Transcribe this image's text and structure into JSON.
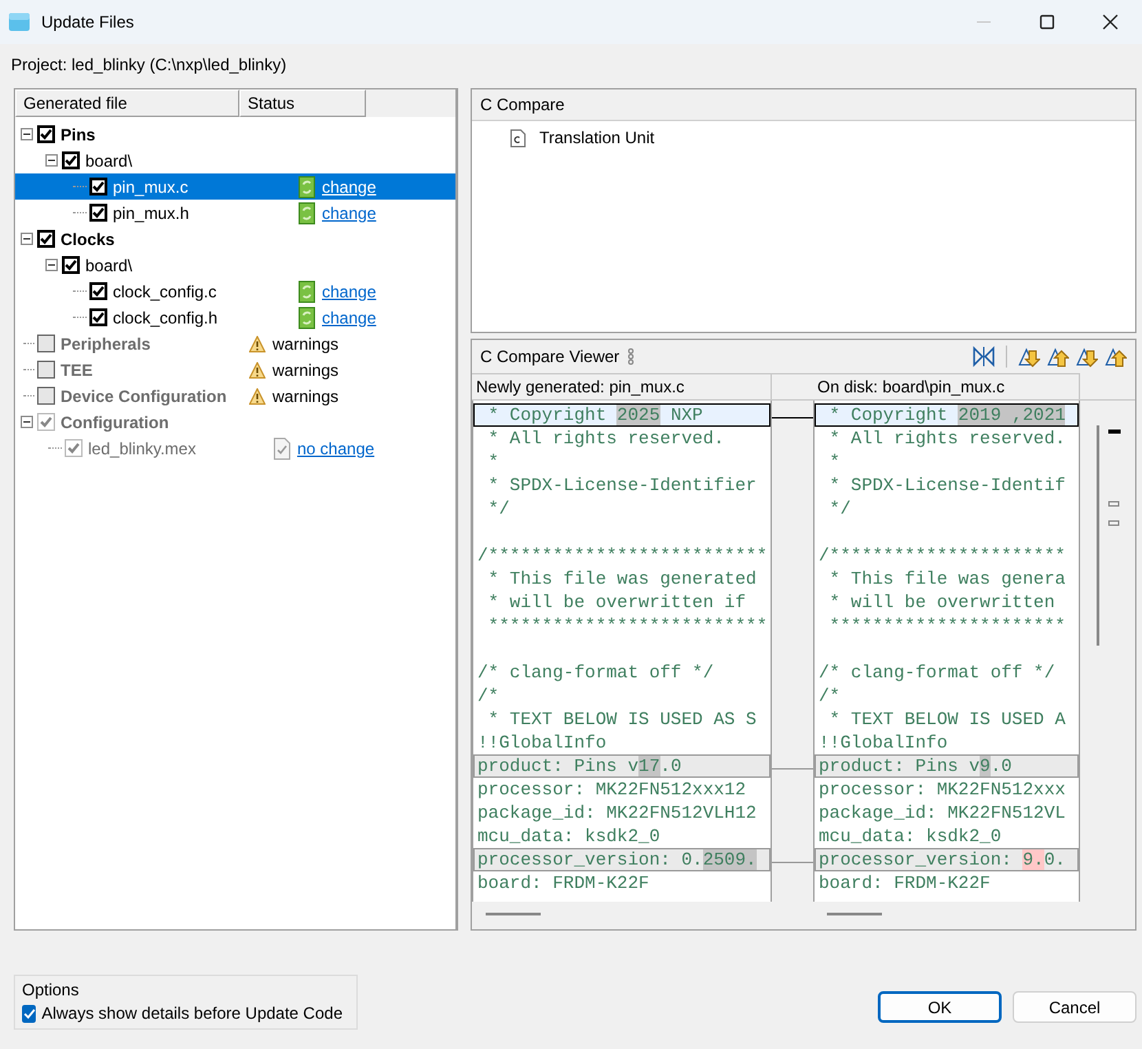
{
  "window": {
    "title": "Update Files"
  },
  "project": "Project: led_blinky (C:\\nxp\\led_blinky)",
  "tree": {
    "columns": [
      "Generated file",
      "Status"
    ],
    "items": [
      {
        "label": "Pins",
        "kind": "group",
        "checked": true,
        "disabled": false,
        "expanded": true,
        "selected": false,
        "children": [
          {
            "label": "board\\",
            "kind": "item",
            "checked": true,
            "disabled": false,
            "expanded": true,
            "selected": false,
            "children": [
              {
                "label": "pin_mux.c",
                "kind": "item",
                "checked": true,
                "disabled": false,
                "selected": true,
                "status": {
                  "kind": "change",
                  "text": "change"
                }
              },
              {
                "label": "pin_mux.h",
                "kind": "item",
                "checked": true,
                "disabled": false,
                "selected": false,
                "status": {
                  "kind": "change",
                  "text": "change"
                }
              }
            ]
          }
        ]
      },
      {
        "label": "Clocks",
        "kind": "group",
        "checked": true,
        "disabled": false,
        "expanded": true,
        "selected": false,
        "children": [
          {
            "label": "board\\",
            "kind": "item",
            "checked": true,
            "disabled": false,
            "expanded": true,
            "selected": false,
            "children": [
              {
                "label": "clock_config.c",
                "kind": "item",
                "checked": true,
                "disabled": false,
                "selected": false,
                "status": {
                  "kind": "change",
                  "text": "change"
                }
              },
              {
                "label": "clock_config.h",
                "kind": "item",
                "checked": true,
                "disabled": false,
                "selected": false,
                "status": {
                  "kind": "change",
                  "text": "change"
                }
              }
            ]
          }
        ]
      },
      {
        "label": "Peripherals",
        "kind": "group",
        "checked": false,
        "disabled": true,
        "selected": false,
        "status": {
          "kind": "warning",
          "text": "warnings"
        }
      },
      {
        "label": "TEE",
        "kind": "group",
        "checked": false,
        "disabled": true,
        "selected": false,
        "status": {
          "kind": "warning",
          "text": "warnings"
        }
      },
      {
        "label": "Device Configuration",
        "kind": "group",
        "checked": false,
        "disabled": true,
        "selected": false,
        "status": {
          "kind": "warning",
          "text": "warnings"
        }
      },
      {
        "label": "Configuration",
        "kind": "group",
        "checked": true,
        "disabled": true,
        "expanded": true,
        "selected": false,
        "children": [
          {
            "label": "led_blinky.mex",
            "kind": "item",
            "checked": true,
            "disabled": true,
            "selected": false,
            "status": {
              "kind": "nochange",
              "text": "no change"
            }
          }
        ]
      }
    ]
  },
  "compare": {
    "title": "C Compare",
    "items": [
      {
        "label": "Translation Unit"
      }
    ]
  },
  "viewer": {
    "title": "C Compare Viewer",
    "left": {
      "title": "Newly generated: pin_mux.c",
      "lines": [
        {
          "kind": "current-diff",
          "segments": [
            {
              "kind": "plain",
              "text": " * Copyright "
            },
            {
              "kind": "change",
              "text": "2025"
            },
            {
              "kind": "plain",
              "text": " NXP"
            }
          ]
        },
        {
          "kind": "text",
          "segments": [
            {
              "kind": "plain",
              "text": " * All rights reserved."
            }
          ]
        },
        {
          "kind": "text",
          "segments": [
            {
              "kind": "plain",
              "text": " *"
            }
          ]
        },
        {
          "kind": "text",
          "segments": [
            {
              "kind": "plain",
              "text": " * SPDX-License-Identifier"
            }
          ]
        },
        {
          "kind": "text",
          "segments": [
            {
              "kind": "plain",
              "text": " */"
            }
          ]
        },
        {
          "kind": "blank"
        },
        {
          "kind": "text",
          "segments": [
            {
              "kind": "plain",
              "text": "/**************************"
            }
          ]
        },
        {
          "kind": "text",
          "segments": [
            {
              "kind": "plain",
              "text": " * This file was generated"
            }
          ]
        },
        {
          "kind": "text",
          "segments": [
            {
              "kind": "plain",
              "text": " * will be overwritten if"
            }
          ]
        },
        {
          "kind": "text",
          "segments": [
            {
              "kind": "plain",
              "text": " **************************"
            }
          ]
        },
        {
          "kind": "blank"
        },
        {
          "kind": "text",
          "segments": [
            {
              "kind": "plain",
              "text": "/* clang-format off */"
            }
          ]
        },
        {
          "kind": "text",
          "segments": [
            {
              "kind": "plain",
              "text": "/*"
            }
          ]
        },
        {
          "kind": "text",
          "segments": [
            {
              "kind": "plain",
              "text": " * TEXT BELOW IS USED AS S"
            }
          ]
        },
        {
          "kind": "text",
          "segments": [
            {
              "kind": "plain",
              "text": "!!GlobalInfo"
            }
          ]
        },
        {
          "kind": "diff",
          "segments": [
            {
              "kind": "plain",
              "text": "product: Pins v"
            },
            {
              "kind": "change",
              "text": "17"
            },
            {
              "kind": "plain",
              "text": ".0"
            }
          ]
        },
        {
          "kind": "text",
          "segments": [
            {
              "kind": "plain",
              "text": "processor: MK22FN512xxx12"
            }
          ]
        },
        {
          "kind": "text",
          "segments": [
            {
              "kind": "plain",
              "text": "package_id: MK22FN512VLH12"
            }
          ]
        },
        {
          "kind": "text",
          "segments": [
            {
              "kind": "plain",
              "text": "mcu_data: ksdk2_0"
            }
          ]
        },
        {
          "kind": "diff",
          "segments": [
            {
              "kind": "plain",
              "text": "processor_version: 0."
            },
            {
              "kind": "change",
              "text": "2509."
            }
          ]
        },
        {
          "kind": "text",
          "segments": [
            {
              "kind": "plain",
              "text": "board: FRDM-K22F"
            }
          ]
        }
      ]
    },
    "right": {
      "title": "On disk: board\\pin_mux.c",
      "lines": [
        {
          "kind": "current-diff",
          "segments": [
            {
              "kind": "plain",
              "text": " * Copyright "
            },
            {
              "kind": "change",
              "text": "2019 ,2021"
            }
          ]
        },
        {
          "kind": "text",
          "segments": [
            {
              "kind": "plain",
              "text": " * All rights reserved."
            }
          ]
        },
        {
          "kind": "text",
          "segments": [
            {
              "kind": "plain",
              "text": " *"
            }
          ]
        },
        {
          "kind": "text",
          "segments": [
            {
              "kind": "plain",
              "text": " * SPDX-License-Identif"
            }
          ]
        },
        {
          "kind": "text",
          "segments": [
            {
              "kind": "plain",
              "text": " */"
            }
          ]
        },
        {
          "kind": "blank"
        },
        {
          "kind": "text",
          "segments": [
            {
              "kind": "plain",
              "text": "/**********************"
            }
          ]
        },
        {
          "kind": "text",
          "segments": [
            {
              "kind": "plain",
              "text": " * This file was genera"
            }
          ]
        },
        {
          "kind": "text",
          "segments": [
            {
              "kind": "plain",
              "text": " * will be overwritten"
            }
          ]
        },
        {
          "kind": "text",
          "segments": [
            {
              "kind": "plain",
              "text": " **********************"
            }
          ]
        },
        {
          "kind": "blank"
        },
        {
          "kind": "text",
          "segments": [
            {
              "kind": "plain",
              "text": "/* clang-format off */"
            }
          ]
        },
        {
          "kind": "text",
          "segments": [
            {
              "kind": "plain",
              "text": "/*"
            }
          ]
        },
        {
          "kind": "text",
          "segments": [
            {
              "kind": "plain",
              "text": " * TEXT BELOW IS USED A"
            }
          ]
        },
        {
          "kind": "text",
          "segments": [
            {
              "kind": "plain",
              "text": "!!GlobalInfo"
            }
          ]
        },
        {
          "kind": "diff",
          "segments": [
            {
              "kind": "plain",
              "text": "product: Pins v"
            },
            {
              "kind": "change",
              "text": "9"
            },
            {
              "kind": "plain",
              "text": ".0"
            }
          ]
        },
        {
          "kind": "text",
          "segments": [
            {
              "kind": "plain",
              "text": "processor: MK22FN512xxx"
            }
          ]
        },
        {
          "kind": "text",
          "segments": [
            {
              "kind": "plain",
              "text": "package_id: MK22FN512VL"
            }
          ]
        },
        {
          "kind": "text",
          "segments": [
            {
              "kind": "plain",
              "text": "mcu_data: ksdk2_0"
            }
          ]
        },
        {
          "kind": "diff",
          "segments": [
            {
              "kind": "plain",
              "text": "processor_version: "
            },
            {
              "kind": "conflict",
              "text": "9."
            },
            {
              "kind": "plain",
              "text": "0."
            }
          ]
        },
        {
          "kind": "text",
          "segments": [
            {
              "kind": "plain",
              "text": "board: FRDM-K22F"
            }
          ]
        }
      ]
    }
  },
  "options": {
    "title": "Options",
    "items": [
      {
        "label": "Always show details before Update Code",
        "checked": true
      }
    ]
  },
  "buttons": [
    {
      "label": "OK",
      "default": true
    },
    {
      "label": "Cancel",
      "default": false
    }
  ]
}
